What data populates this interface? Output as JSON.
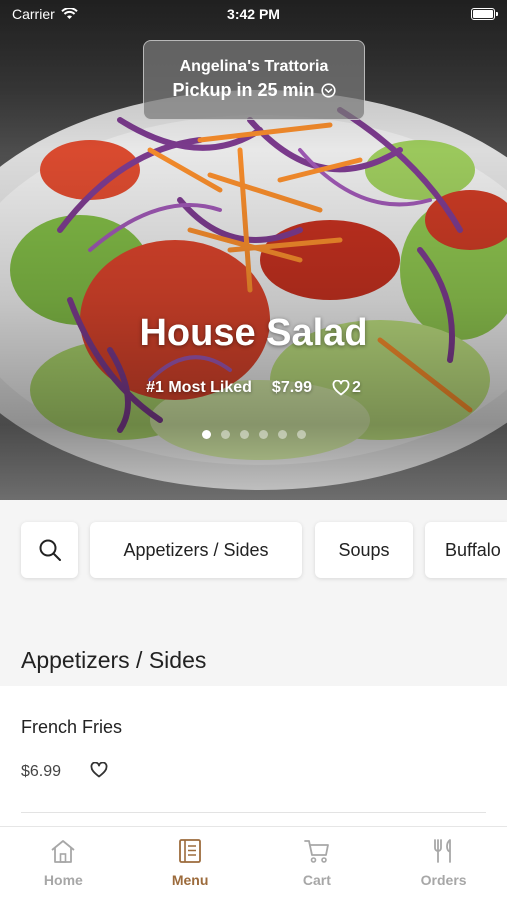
{
  "status_bar": {
    "carrier": "Carrier",
    "time": "3:42 PM"
  },
  "pickup": {
    "restaurant": "Angelina's Trattoria",
    "eta": "Pickup in 25 min"
  },
  "featured": {
    "title": "House Salad",
    "rank": "#1 Most Liked",
    "price": "$7.99",
    "likes": "2",
    "slides_total": 6,
    "slide_active": 1
  },
  "categories": [
    "Appetizers / Sides",
    "Soups",
    "Buffalo"
  ],
  "section": {
    "title": "Appetizers / Sides"
  },
  "items": [
    {
      "name": "French Fries",
      "price": "$6.99"
    }
  ],
  "tabs": [
    {
      "label": "Home",
      "icon": "home-icon"
    },
    {
      "label": "Menu",
      "icon": "menu-book-icon",
      "active": true
    },
    {
      "label": "Cart",
      "icon": "cart-icon"
    },
    {
      "label": "Orders",
      "icon": "fork-knife-icon"
    }
  ],
  "colors": {
    "accent": "#9c6b3c",
    "inactive": "#a7a7a7"
  }
}
